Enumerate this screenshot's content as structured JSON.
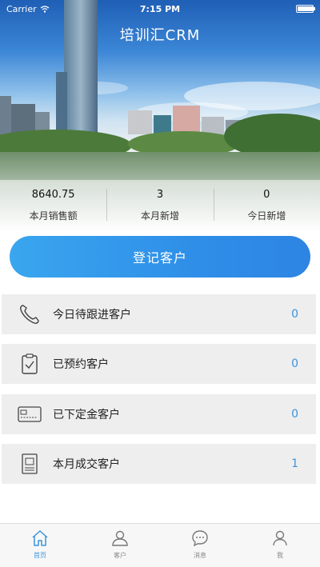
{
  "status_bar": {
    "carrier": "Carrier",
    "time": "7:15 PM"
  },
  "app": {
    "title": "培训汇CRM"
  },
  "stats": [
    {
      "value": "8640.75",
      "label": "本月销售额"
    },
    {
      "value": "3",
      "label": "本月新增"
    },
    {
      "value": "0",
      "label": "今日新增"
    }
  ],
  "register_button": {
    "label": "登记客户"
  },
  "list": [
    {
      "icon": "phone-icon",
      "label": "今日待跟进客户",
      "count": "0"
    },
    {
      "icon": "clipboard-check-icon",
      "label": "已预约客户",
      "count": "0"
    },
    {
      "icon": "card-icon",
      "label": "已下定金客户",
      "count": "0"
    },
    {
      "icon": "document-icon",
      "label": "本月成交客户",
      "count": "1"
    }
  ],
  "tabs": [
    {
      "icon": "home-icon",
      "label": "首页",
      "active": true
    },
    {
      "icon": "customers-icon",
      "label": "客户",
      "active": false
    },
    {
      "icon": "message-icon",
      "label": "消息",
      "active": false
    },
    {
      "icon": "profile-icon",
      "label": "我",
      "active": false
    }
  ],
  "colors": {
    "accent": "#3b93dd",
    "button_start": "#3aa6ef",
    "button_end": "#2d84e3",
    "row_bg": "#eeeeee"
  }
}
